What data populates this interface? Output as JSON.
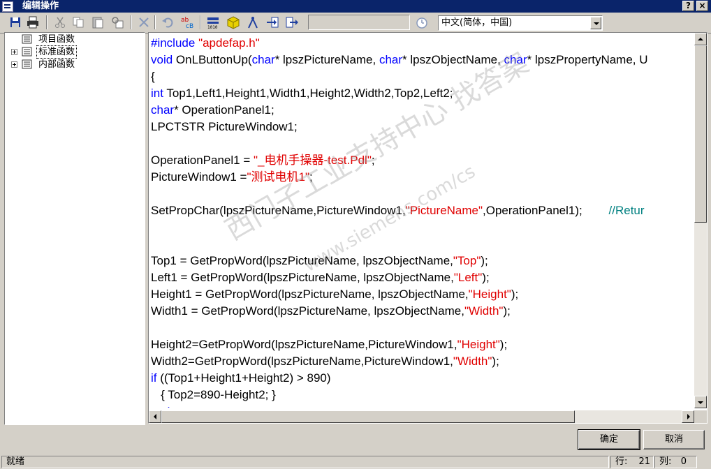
{
  "window": {
    "title": "编辑操作",
    "help_label": "?",
    "close_label": "×"
  },
  "toolbar": {
    "icons": [
      "save-icon",
      "print-icon",
      "cut-icon",
      "copy-icon",
      "paste-icon",
      "find-replace-icon",
      "delete-icon",
      "undo-icon",
      "spell-check-icon",
      "compile-icon",
      "cube-icon",
      "compass-icon",
      "import-icon",
      "export-icon"
    ],
    "language": "中文(简体，中国)"
  },
  "tree": {
    "items": [
      {
        "label": "项目函数",
        "expandable": false
      },
      {
        "label": "标准函数",
        "expandable": true,
        "selected": true
      },
      {
        "label": "内部函数",
        "expandable": true
      }
    ]
  },
  "code": {
    "lines": [
      [
        {
          "t": "#include ",
          "c": "kw"
        },
        {
          "t": "\"apdefap.h\"",
          "c": "str"
        }
      ],
      [
        {
          "t": "void ",
          "c": "kw"
        },
        {
          "t": "OnLButtonUp("
        },
        {
          "t": "char",
          "c": "kw"
        },
        {
          "t": "* lpszPictureName, "
        },
        {
          "t": "char",
          "c": "kw"
        },
        {
          "t": "* lpszObjectName, "
        },
        {
          "t": "char",
          "c": "kw"
        },
        {
          "t": "* lpszPropertyName, U"
        }
      ],
      [
        {
          "t": "{"
        }
      ],
      [
        {
          "t": "int ",
          "c": "kw"
        },
        {
          "t": "Top1,Left1,Height1,Width1,Height2,Width2,Top2,Left2;"
        }
      ],
      [
        {
          "t": "char",
          "c": "kw"
        },
        {
          "t": "* OperationPanel1;"
        }
      ],
      [
        {
          "t": "LPCTSTR PictureWindow1;"
        }
      ],
      [
        {
          "t": ""
        }
      ],
      [
        {
          "t": "OperationPanel1 = "
        },
        {
          "t": "\"_电机手操器-test.Pdl\"",
          "c": "str"
        },
        {
          "t": ";"
        }
      ],
      [
        {
          "t": "PictureWindow1 ="
        },
        {
          "t": "\"测试电机1\"",
          "c": "str"
        },
        {
          "t": ";"
        }
      ],
      [
        {
          "t": ""
        }
      ],
      [
        {
          "t": "SetPropChar(lpszPictureName,PictureWindow1,"
        },
        {
          "t": "\"PictureName\"",
          "c": "str"
        },
        {
          "t": ",OperationPanel1);        "
        },
        {
          "t": "//Retur",
          "c": "cm"
        }
      ],
      [
        {
          "t": ""
        }
      ],
      [
        {
          "t": ""
        }
      ],
      [
        {
          "t": "Top1 = GetPropWord(lpszPictureName, lpszObjectName,"
        },
        {
          "t": "\"Top\"",
          "c": "str"
        },
        {
          "t": ");"
        }
      ],
      [
        {
          "t": "Left1 = GetPropWord(lpszPictureName, lpszObjectName,"
        },
        {
          "t": "\"Left\"",
          "c": "str"
        },
        {
          "t": ");"
        }
      ],
      [
        {
          "t": "Height1 = GetPropWord(lpszPictureName, lpszObjectName,"
        },
        {
          "t": "\"Height\"",
          "c": "str"
        },
        {
          "t": ");"
        }
      ],
      [
        {
          "t": "Width1 = GetPropWord(lpszPictureName, lpszObjectName,"
        },
        {
          "t": "\"Width\"",
          "c": "str"
        },
        {
          "t": ");"
        }
      ],
      [
        {
          "t": ""
        }
      ],
      [
        {
          "t": "Height2=GetPropWord(lpszPictureName,PictureWindow1,"
        },
        {
          "t": "\"Height\"",
          "c": "str"
        },
        {
          "t": ");"
        }
      ],
      [
        {
          "t": "Width2=GetPropWord(lpszPictureName,PictureWindow1,"
        },
        {
          "t": "\"Width\"",
          "c": "str"
        },
        {
          "t": ");"
        }
      ],
      [
        {
          "t": "if ",
          "c": "kw"
        },
        {
          "t": "((Top1+Height1+Height2) > 890)"
        }
      ],
      [
        {
          "t": "   { Top2=890-Height2; }"
        }
      ],
      [
        {
          "t": "   else",
          "c": "kw"
        }
      ]
    ]
  },
  "watermark": {
    "text": "西门子工业支持中心 找答案",
    "url": "www.siemens.com/cs"
  },
  "buttons": {
    "ok": "确定",
    "cancel": "取消"
  },
  "status": {
    "message": "就绪",
    "row_label": "行:",
    "row_value": "21",
    "col_label": "列:",
    "col_value": "0"
  },
  "colors": {
    "titlebar": "#0a246a",
    "keyword": "#0000ff",
    "string": "#e00000",
    "comment": "#008080"
  }
}
